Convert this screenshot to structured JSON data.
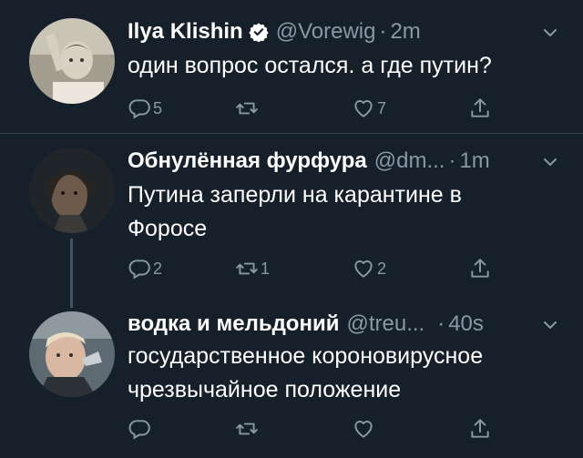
{
  "tweets": [
    {
      "name": "Ilya Klishin",
      "verified": true,
      "handle": "@Vorewig",
      "time": "2m",
      "text": "один вопрос остался. а где путин?",
      "replies": "5",
      "retweets": "",
      "likes": "7"
    },
    {
      "name": "Обнулённая фурфура",
      "verified": false,
      "handle": "@dm...",
      "time": "1m",
      "text": "Путина заперли на карантине в Форосе",
      "replies": "2",
      "retweets": "1",
      "likes": "2"
    },
    {
      "name": "водка и мельдоний",
      "verified": false,
      "handle": "@treu...",
      "time": "40s",
      "text": "государственное короновирусное чрезвычайное положение",
      "replies": "",
      "retweets": "",
      "likes": ""
    }
  ],
  "colors": {
    "background": "#15202b",
    "secondary_text": "#8899a6",
    "divider": "#38444d",
    "verified": "#ffffff"
  },
  "icons": {
    "reply": "speech-bubble-icon",
    "retweet": "retweet-arrows-icon",
    "like": "heart-icon",
    "share": "share-upload-icon",
    "caret": "chevron-down-icon"
  }
}
